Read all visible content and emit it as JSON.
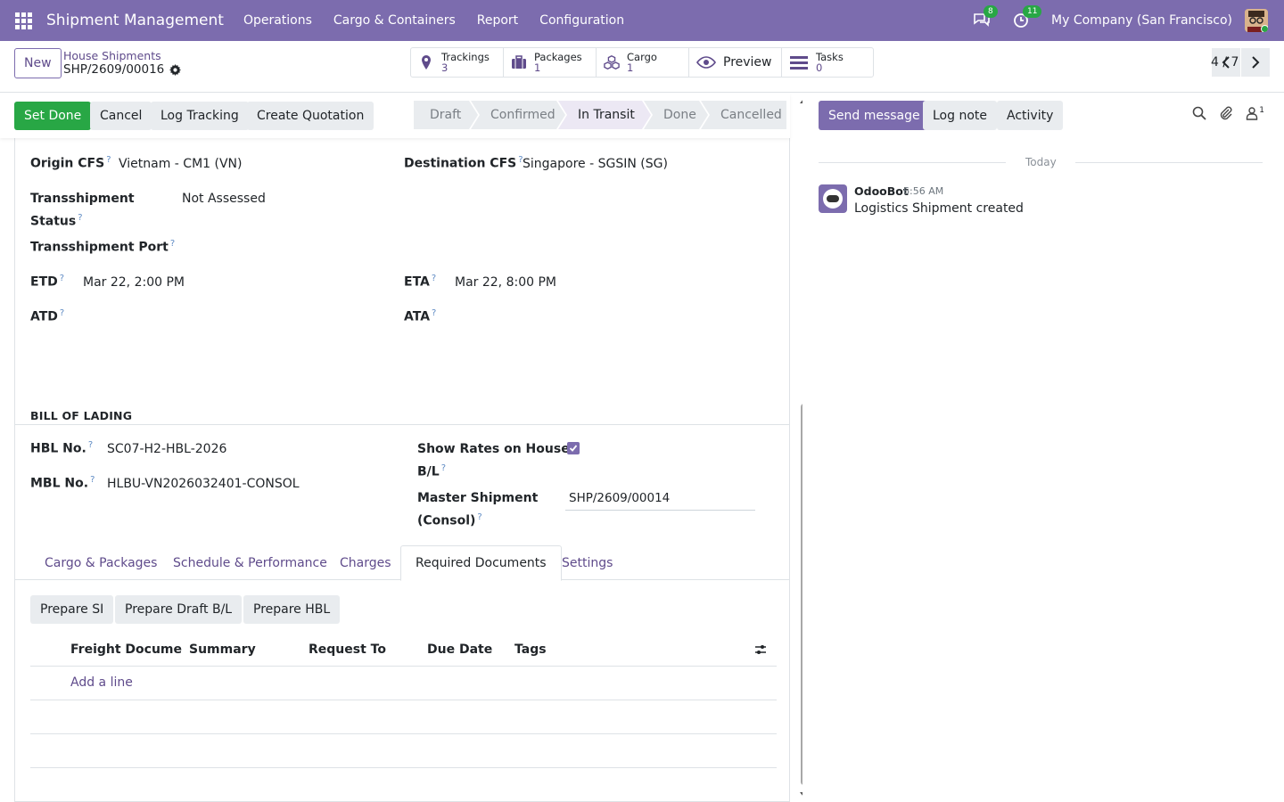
{
  "navbar": {
    "app_title": "Shipment Management",
    "menus": [
      "Operations",
      "Cargo & Containers",
      "Report",
      "Configuration"
    ],
    "messages_count": "8",
    "activities_count": "11",
    "company": "My Company (San Francisco)"
  },
  "control": {
    "new_label": "New",
    "breadcrumb_parent": "House Shipments",
    "record_name": "SHP/2609/00016",
    "smart_buttons": [
      {
        "label": "Trackings",
        "count": "3"
      },
      {
        "label": "Packages",
        "count": "1"
      },
      {
        "label": "Cargo",
        "count": "1"
      },
      {
        "label": "Preview",
        "count": ""
      },
      {
        "label": "Tasks",
        "count": "0"
      }
    ],
    "pager": "4 / 7"
  },
  "statusbar": {
    "buttons": [
      "Set Done",
      "Cancel",
      "Log Tracking",
      "Create Quotation"
    ],
    "stages": [
      "Draft",
      "Confirmed",
      "In Transit",
      "Done",
      "Cancelled"
    ],
    "active_stage": "In Transit"
  },
  "form": {
    "origin_cfs_label": "Origin CFS",
    "origin_cfs": "Vietnam - CM1 (VN)",
    "destination_cfs_label": "Destination CFS",
    "destination_cfs": "Singapore - SGSIN (SG)",
    "transshipment_status_label_1": "Transshipment",
    "transshipment_status_label_2": "Status",
    "transshipment_status": "Not Assessed",
    "transshipment_port_label": "Transshipment Port",
    "etd_label": "ETD",
    "etd": "Mar 22, 2:00 PM",
    "eta_label": "ETA",
    "eta": "Mar 22, 8:00 PM",
    "atd_label": "ATD",
    "ata_label": "ATA",
    "bill_of_lading_title": "BILL OF LADING",
    "hbl_label": "HBL No.",
    "hbl": "SC07-H2-HBL-2026",
    "mbl_label": "MBL No.",
    "mbl": "HLBU-VN2026032401-CONSOL",
    "show_rates_label_1": "Show Rates on House",
    "show_rates_label_2": "B/L",
    "show_rates_checked": true,
    "master_shipment_label_1": "Master Shipment",
    "master_shipment_label_2": "(Consol)",
    "master_shipment": "SHP/2609/00014",
    "help_mark": "?"
  },
  "tabs": [
    "Cargo & Packages",
    "Schedule & Performance",
    "Charges",
    "Required Documents",
    "Settings"
  ],
  "active_tab": "Required Documents",
  "documents": {
    "buttons": [
      "Prepare SI",
      "Prepare Draft B/L",
      "Prepare HBL"
    ],
    "columns": [
      "Freight Docume...",
      "Summary",
      "Request To",
      "Due Date",
      "Tags"
    ],
    "add_line": "Add a line"
  },
  "chatter": {
    "send_message": "Send message",
    "log_note": "Log note",
    "activity": "Activity",
    "followers_count": "1",
    "date_separator": "Today",
    "messages": [
      {
        "author": "OdooBot",
        "time": "6:56 AM",
        "body": "Logistics Shipment created"
      }
    ]
  },
  "colors": {
    "navbar": "#7c6cae",
    "primary_green": "#28a745",
    "accent_purple": "#5f4b8b"
  }
}
